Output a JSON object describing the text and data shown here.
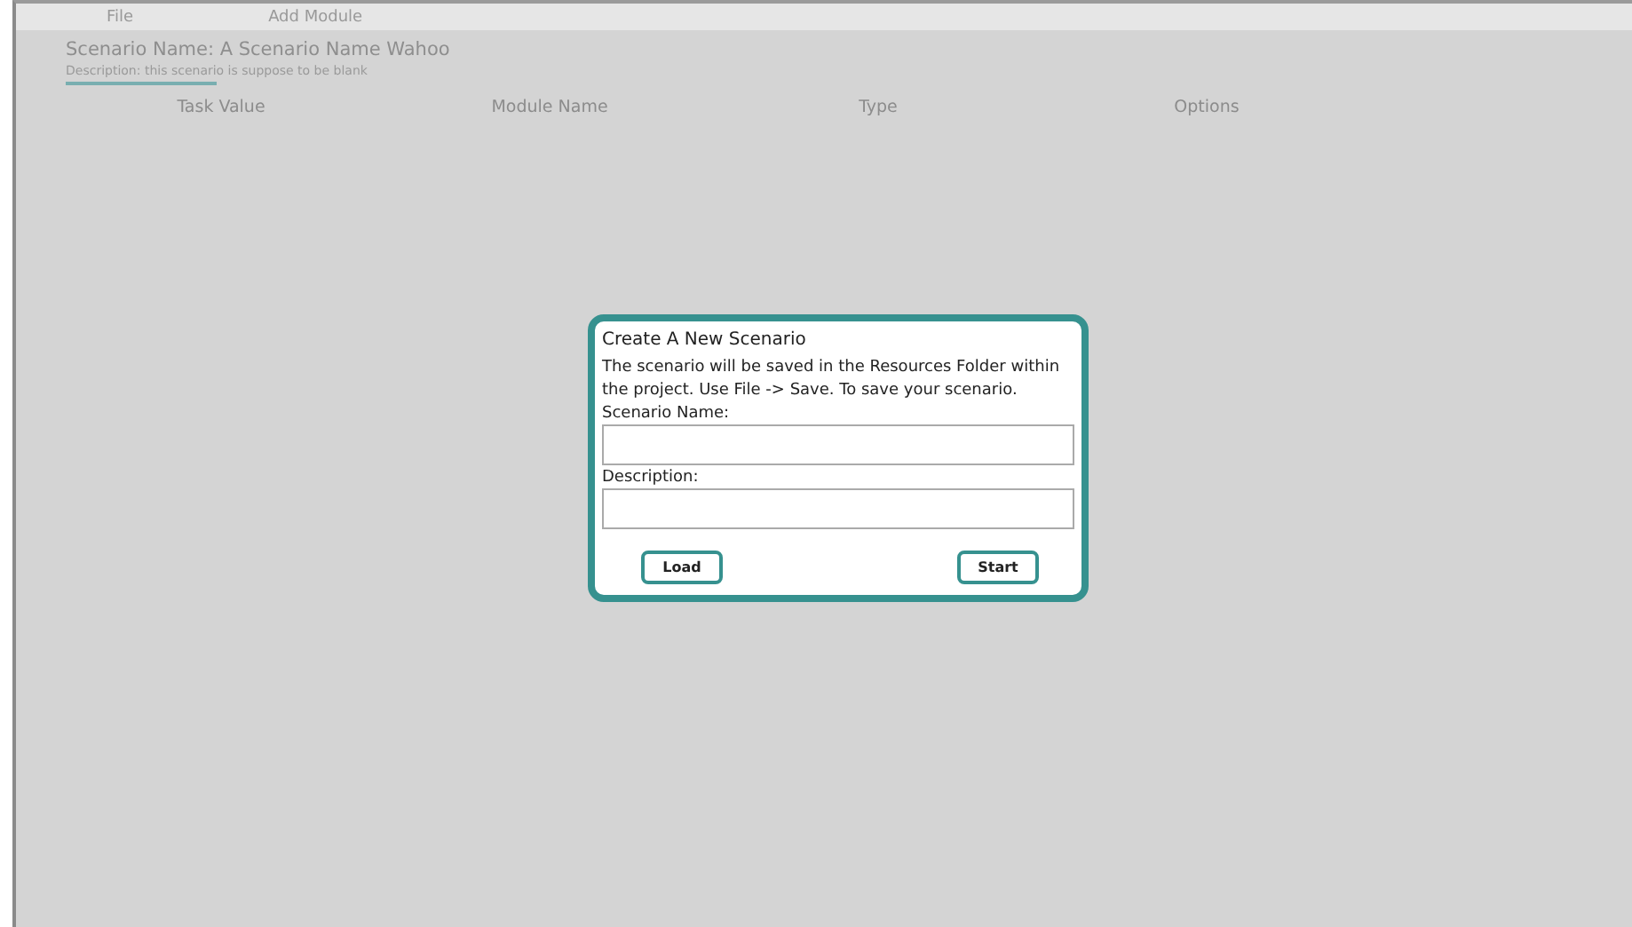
{
  "menu": [
    {
      "label": "File"
    },
    {
      "label": "Add Module"
    }
  ],
  "scenario": {
    "name": "Scenario Name: A Scenario Name Wahoo",
    "description": "Description: this scenario is suppose to be blank"
  },
  "table": {
    "columns": [
      "Task Value",
      "Module Name",
      "Type",
      "Options"
    ]
  },
  "dialog": {
    "title": "Create A New Scenario",
    "message": "The scenario will be saved in the Resources Folder within the project. Use File -> Save. To save your scenario.",
    "fields": [
      {
        "label": "Scenario Name:"
      },
      {
        "label": "Description:"
      }
    ],
    "buttons": [
      "Load",
      "Start"
    ]
  }
}
